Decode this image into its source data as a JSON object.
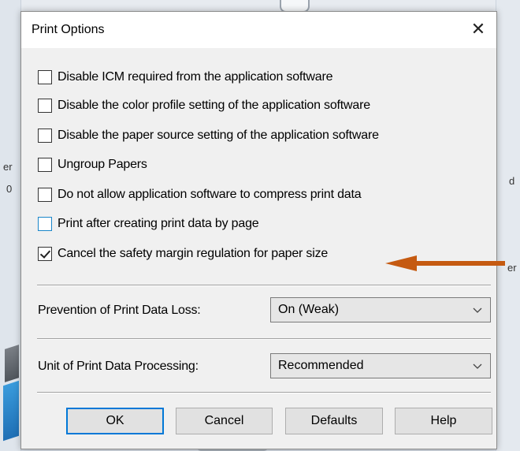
{
  "dialog": {
    "title": "Print Options",
    "close_glyph": "✕"
  },
  "options": [
    {
      "label": "Disable ICM required from the application software",
      "checked": false
    },
    {
      "label": "Disable the color profile setting of the application software",
      "checked": false
    },
    {
      "label": "Disable the paper source setting of the application software",
      "checked": false
    },
    {
      "label": "Ungroup Papers",
      "checked": false
    },
    {
      "label": "Do not allow application software to compress print data",
      "checked": false
    },
    {
      "label": "Print after creating print data by page",
      "checked": false
    },
    {
      "label": "Cancel the safety margin regulation for paper size",
      "checked": true
    }
  ],
  "fields": {
    "prevention": {
      "label": "Prevention of Print Data Loss:",
      "value": "On (Weak)"
    },
    "unit": {
      "label": "Unit of Print Data Processing:",
      "value": "Recommended"
    }
  },
  "buttons": {
    "ok": "OK",
    "cancel": "Cancel",
    "defaults": "Defaults",
    "help": "Help"
  },
  "annotation": {
    "arrow_color": "#c55a11"
  },
  "background": {
    "left_fragment_1": "er",
    "left_fragment_2": "0",
    "right_fragment_1": "d",
    "right_fragment_2": "er"
  },
  "colors": {
    "dialog_bg": "#f0f0f0",
    "title_bg": "#ffffff",
    "default_button_border": "#0078d7",
    "focus_checkbox_border": "#1a86c9"
  },
  "icons": {
    "close": "close-icon",
    "check": "checkmark-icon",
    "dropdown": "chevron-down-icon",
    "annotation": "arrow-left-icon"
  }
}
